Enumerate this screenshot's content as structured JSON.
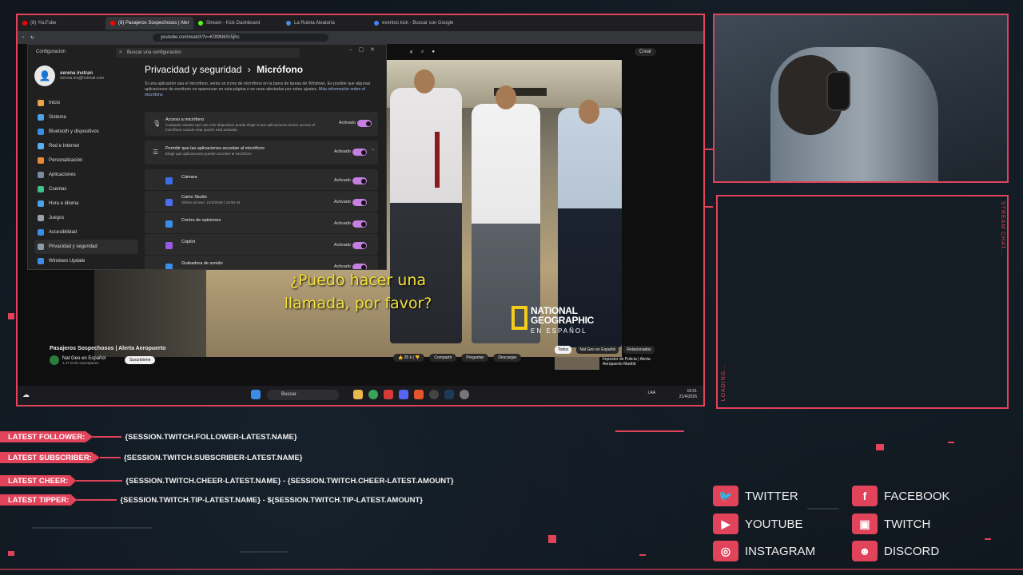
{
  "browser": {
    "tabs": [
      {
        "label": "(8) YouTube",
        "color": "#ff0000"
      },
      {
        "label": "(8) Pasajeros Sospechosos | Aler",
        "color": "#ff0000"
      },
      {
        "label": "Stream - Kick Dashboard",
        "color": "#53fc18"
      },
      {
        "label": "La Ruleta Aleatoria",
        "color": "#4f8bd8"
      },
      {
        "label": "eventos kick - Buscar con Google",
        "color": "#4285f4"
      }
    ],
    "url": "youtube.com/watch?v=K0t9N6Sr5jhc"
  },
  "youtube": {
    "create_label": "Crear",
    "subtitle_line1": "¿Puedo hacer una",
    "subtitle_line2": "llamada, por favor?",
    "watermark_line1": "NATIONAL",
    "watermark_line2": "GEOGRAPHIC",
    "watermark_line3": "EN ESPAÑOL",
    "video_title": "Pasajeros Sospechosos | Alerta Aeropuerto",
    "channel_name": "Nat Geo en Español",
    "channel_subs": "1,47 M de suscriptores",
    "subscribe_label": "Suscribirme",
    "likes": "25 k",
    "share_label": "Compartir",
    "ask_label": "Preguntar",
    "download_label": "Descargar",
    "chips": [
      "Todos",
      "Nat Geo en Español",
      "Relacionados"
    ],
    "rec_title": "Impostor de Policía | Alerta Aeropuerto Madrid"
  },
  "taskbar": {
    "search_label": "Buscar",
    "lang": "LAA",
    "time": "16:51",
    "date": "21/4/2026"
  },
  "settings": {
    "window_title": "Configuración",
    "search_placeholder": "Buscar una configuración",
    "user_name": "serena instran",
    "user_email": "serena.ins@hotmail.com",
    "nav": [
      {
        "label": "Inicio",
        "color": "#e8a54a"
      },
      {
        "label": "Sistema",
        "color": "#4aa3e8"
      },
      {
        "label": "Bluetooth y dispositivos",
        "color": "#3a8ee6"
      },
      {
        "label": "Red e Internet",
        "color": "#5ab0f0"
      },
      {
        "label": "Personalización",
        "color": "#e88a3a"
      },
      {
        "label": "Aplicaciones",
        "color": "#7a8aa0"
      },
      {
        "label": "Cuentas",
        "color": "#3fc08a"
      },
      {
        "label": "Hora e idioma",
        "color": "#4aa3e8"
      },
      {
        "label": "Juegos",
        "color": "#9aa0a8"
      },
      {
        "label": "Accesibilidad",
        "color": "#3a8ee6"
      },
      {
        "label": "Privacidad y seguridad",
        "color": "#8a9aa8"
      },
      {
        "label": "Windows Update",
        "color": "#3a8ee6"
      }
    ],
    "crumb_parent": "Privacidad y seguridad",
    "crumb_sep": "›",
    "crumb_current": "Micrófono",
    "description": "Si una aplicación usa el micrófono, verás un icono de micrófono en la barra de tareas de Windows. Es posible que algunas aplicaciones de escritorio no aparezcan en esta página o se vean afectadas por estos ajustes.",
    "description_link": "Más información sobre el micrófono",
    "access_title": "Acceso a micrófono",
    "access_sub": "Cualquier usuario que use este dispositivo puede elegir si sus aplicaciones tienen acceso al micrófono cuando esta opción está activada",
    "apps_title": "Permitir que las aplicaciones accedan al micrófono",
    "apps_sub": "Elegir qué aplicaciones pueden acceder al micrófono",
    "state_on": "Activado",
    "apps": [
      {
        "name": "Cámara",
        "sub": "",
        "color": "#3a6ee6"
      },
      {
        "name": "Camo Studio",
        "sub": "Último acceso: 21/4/2026 | 15:50:44",
        "color": "#4a6ef0"
      },
      {
        "name": "Centro de opiniones",
        "sub": "",
        "color": "#3a8ee6"
      },
      {
        "name": "Copilot",
        "sub": "",
        "color": "#9a5ae0"
      },
      {
        "name": "Grabadora de sonido",
        "sub": "",
        "color": "#3a8ee6"
      }
    ]
  },
  "overlay": {
    "stats": [
      {
        "label": "LATEST FOLLOWER:",
        "value": "{SESSION.TWITCH.FOLLOWER-LATEST.NAME}"
      },
      {
        "label": "LATEST SUBSCRIBER:",
        "value": "{SESSION.TWITCH.SUBSCRIBER-LATEST.NAME}"
      },
      {
        "label": "LATEST CHEER:",
        "value": "{SESSION.TWITCH.CHEER-LATEST.NAME} - {SESSION.TWITCH.CHEER-LATEST.AMOUNT}"
      },
      {
        "label": "LATEST TIPPER:",
        "value": "{SESSION.TWITCH.TIP-LATEST.NAME} - ${SESSION.TWITCH.TIP-LATEST.AMOUNT}"
      }
    ],
    "socials": [
      {
        "label": "TWITTER",
        "icon": "twitter-icon"
      },
      {
        "label": "FACEBOOK",
        "icon": "facebook-icon"
      },
      {
        "label": "YOUTUBE",
        "icon": "youtube-icon"
      },
      {
        "label": "TWITCH",
        "icon": "twitch-icon"
      },
      {
        "label": "INSTAGRAM",
        "icon": "instagram-icon"
      },
      {
        "label": "DISCORD",
        "icon": "discord-icon"
      }
    ],
    "chat_label": "STREAM CHAT...",
    "loading_label": "LOADING...",
    "accent_color": "#e0435a"
  }
}
